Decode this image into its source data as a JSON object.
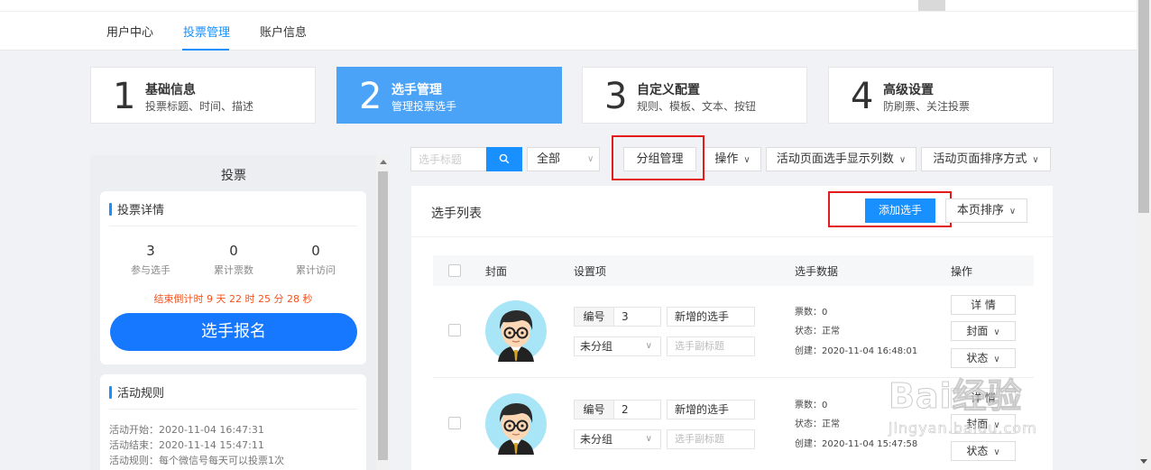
{
  "nav": {
    "tabs": [
      {
        "label": "用户中心"
      },
      {
        "label": "投票管理"
      },
      {
        "label": "账户信息"
      }
    ]
  },
  "steps": [
    {
      "num": "1",
      "title": "基础信息",
      "desc": "投票标题、时间、描述"
    },
    {
      "num": "2",
      "title": "选手管理",
      "desc": "管理投票选手"
    },
    {
      "num": "3",
      "title": "自定义配置",
      "desc": "规则、模板、文本、按钮"
    },
    {
      "num": "4",
      "title": "高级设置",
      "desc": "防刷票、关注投票"
    }
  ],
  "left": {
    "title": "投票",
    "details": {
      "heading": "投票详情",
      "stats": [
        {
          "value": "3",
          "label": "参与选手"
        },
        {
          "value": "0",
          "label": "累计票数"
        },
        {
          "value": "0",
          "label": "累计访问"
        }
      ],
      "countdown": "结束倒计时  9  天 22 时 25 分 28 秒",
      "signup": "选手报名"
    },
    "rules": {
      "heading": "活动规则",
      "lines": [
        "活动开始：2020-11-04 16:47:31",
        "活动结束：2020-11-14 15:47:11",
        "活动规则：每个微信号每天可以投票1次"
      ]
    }
  },
  "toolbar": {
    "search_placeholder": "选手标题",
    "filter": "全部",
    "group_manage": "分组管理",
    "operate": "操作",
    "columns": "活动页面选手显示列数",
    "sort": "活动页面排序方式"
  },
  "list": {
    "title": "选手列表",
    "add": "添加选手",
    "page_sort": "本页排序",
    "headers": {
      "cover": "封面",
      "settings": "设置项",
      "data": "选手数据",
      "ops": "操作"
    },
    "rows": [
      {
        "num_label": "编号",
        "num": "3",
        "name": "新增的选手",
        "group": "未分组",
        "subtitle_placeholder": "选手副标题",
        "votes": "票数：0",
        "status": "状态：正常",
        "created": "创建：2020-11-04 16:48:01",
        "detail": "详 情",
        "cover": "封面",
        "state": "状态"
      },
      {
        "num_label": "编号",
        "num": "2",
        "name": "新增的选手",
        "group": "未分组",
        "subtitle_placeholder": "选手副标题",
        "votes": "票数：0",
        "status": "状态：正常",
        "created": "创建：2020-11-04 15:47:58",
        "detail": "详 情",
        "cover": "封面",
        "state": "状态"
      }
    ]
  },
  "watermark": {
    "main": "Bai经验",
    "sub": "jingyan.baidu.com"
  },
  "colors": {
    "accent": "#1890ff",
    "step_active": "#4ba3f8",
    "signup": "#1677ff",
    "countdown": "#f5531d",
    "highlight": "#e31b1b"
  }
}
